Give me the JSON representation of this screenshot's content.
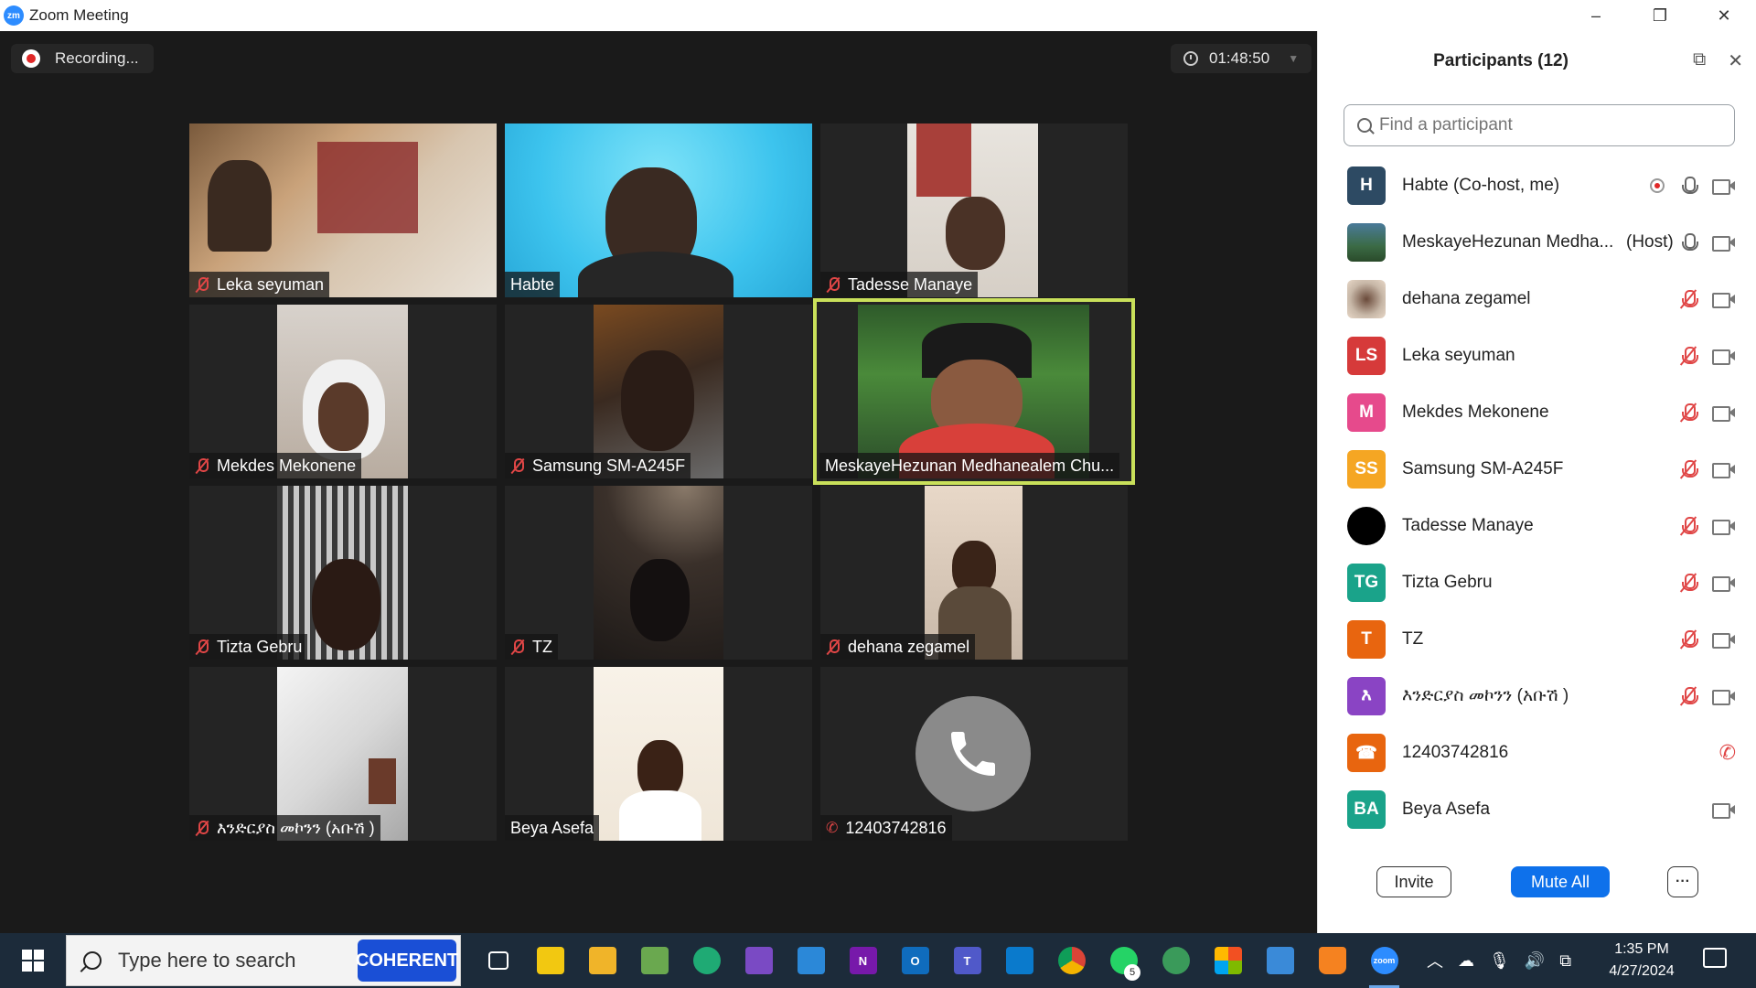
{
  "window": {
    "app_logo": "zm",
    "title": "Zoom Meeting",
    "controls": {
      "minimize": "–",
      "restore": "❐",
      "close": "✕"
    }
  },
  "meeting": {
    "recording_label": "Recording...",
    "timer": "01:48:50",
    "tiles": [
      {
        "name": "Leka seyuman",
        "muted": true
      },
      {
        "name": "Habte",
        "muted": false
      },
      {
        "name": "Tadesse Manaye",
        "muted": true
      },
      {
        "name": "Mekdes Mekonene",
        "muted": true
      },
      {
        "name": "Samsung SM-A245F",
        "muted": true
      },
      {
        "name": "MeskayeHezunan Medhanealem Chu...",
        "muted": false,
        "active_speaker": true
      },
      {
        "name": "Tizta Gebru",
        "muted": true
      },
      {
        "name": "TZ",
        "muted": true
      },
      {
        "name": "dehana zegamel",
        "muted": true
      },
      {
        "name": "እንድርያስ መኮንን (አቡሽ )",
        "muted": true
      },
      {
        "name": "Beya Asefa",
        "muted": false
      },
      {
        "name": "12403742816",
        "muted": true,
        "phone": true
      }
    ]
  },
  "participants": {
    "title": "Participants (12)",
    "search_placeholder": "Find a participant",
    "list": [
      {
        "initials": "H",
        "color": "#2d4a63",
        "name": "Habte (Co-host, me)",
        "role": "",
        "mic": "on",
        "recording": true
      },
      {
        "initials": "",
        "color": "#3b6b45",
        "name": "MeskayeHezunan Medha...",
        "role": "(Host)",
        "mic": "on"
      },
      {
        "initials": "",
        "color": "#8a6e5a",
        "name": "dehana zegamel",
        "role": "",
        "mic": "muted"
      },
      {
        "initials": "LS",
        "color": "#d63a3a",
        "name": "Leka seyuman",
        "role": "",
        "mic": "muted"
      },
      {
        "initials": "M",
        "color": "#e64a8c",
        "name": "Mekdes Mekonene",
        "role": "",
        "mic": "muted"
      },
      {
        "initials": "SS",
        "color": "#f5a623",
        "name": "Samsung SM-A245F",
        "role": "",
        "mic": "muted"
      },
      {
        "initials": "",
        "color": "#000000",
        "name": "Tadesse Manaye",
        "role": "",
        "mic": "muted"
      },
      {
        "initials": "TG",
        "color": "#1aa38a",
        "name": "Tizta Gebru",
        "role": "",
        "mic": "muted"
      },
      {
        "initials": "T",
        "color": "#e8650f",
        "name": "TZ",
        "role": "",
        "mic": "muted"
      },
      {
        "initials": "እ",
        "color": "#8a44c4",
        "name": "እንድርያስ መኮንን (አቡሽ )",
        "role": "",
        "mic": "muted"
      },
      {
        "initials": "☎",
        "color": "#e8650f",
        "name": "12403742816",
        "role": "",
        "mic": "phone-muted"
      },
      {
        "initials": "BA",
        "color": "#1aa38a",
        "name": "Beya Asefa",
        "role": "",
        "mic": "none"
      }
    ],
    "invite_label": "Invite",
    "mute_all_label": "Mute All",
    "more_label": "···"
  },
  "taskbar": {
    "search_placeholder": "Type here to search",
    "coherent_label": "COHERENT",
    "whatsapp_badge": "5",
    "time": "1:35 PM",
    "date": "4/27/2024"
  },
  "colors": {
    "accent": "#0e71eb",
    "active_speaker": "#c9e05a",
    "muted": "#e04646"
  }
}
